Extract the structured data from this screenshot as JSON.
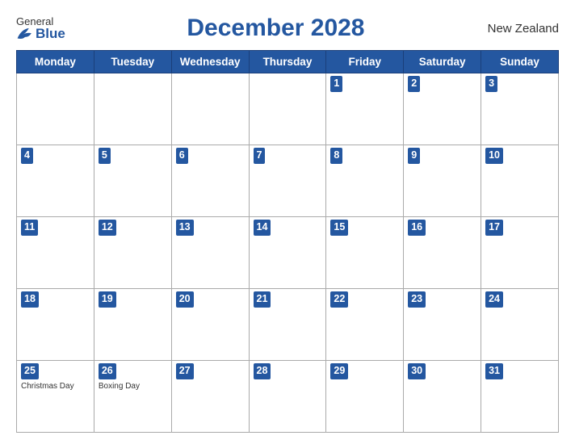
{
  "header": {
    "logo_general": "General",
    "logo_blue": "Blue",
    "title": "December 2028",
    "country": "New Zealand"
  },
  "calendar": {
    "days_of_week": [
      "Monday",
      "Tuesday",
      "Wednesday",
      "Thursday",
      "Friday",
      "Saturday",
      "Sunday"
    ],
    "weeks": [
      [
        {
          "num": "",
          "empty": true
        },
        {
          "num": "",
          "empty": true
        },
        {
          "num": "",
          "empty": true
        },
        {
          "num": "",
          "empty": true
        },
        {
          "num": "1"
        },
        {
          "num": "2"
        },
        {
          "num": "3"
        }
      ],
      [
        {
          "num": "4"
        },
        {
          "num": "5"
        },
        {
          "num": "6"
        },
        {
          "num": "7"
        },
        {
          "num": "8"
        },
        {
          "num": "9"
        },
        {
          "num": "10"
        }
      ],
      [
        {
          "num": "11"
        },
        {
          "num": "12"
        },
        {
          "num": "13"
        },
        {
          "num": "14"
        },
        {
          "num": "15"
        },
        {
          "num": "16"
        },
        {
          "num": "17"
        }
      ],
      [
        {
          "num": "18"
        },
        {
          "num": "19"
        },
        {
          "num": "20"
        },
        {
          "num": "21"
        },
        {
          "num": "22"
        },
        {
          "num": "23"
        },
        {
          "num": "24"
        }
      ],
      [
        {
          "num": "25",
          "holiday": "Christmas Day"
        },
        {
          "num": "26",
          "holiday": "Boxing Day"
        },
        {
          "num": "27"
        },
        {
          "num": "28"
        },
        {
          "num": "29"
        },
        {
          "num": "30"
        },
        {
          "num": "31"
        }
      ]
    ]
  }
}
